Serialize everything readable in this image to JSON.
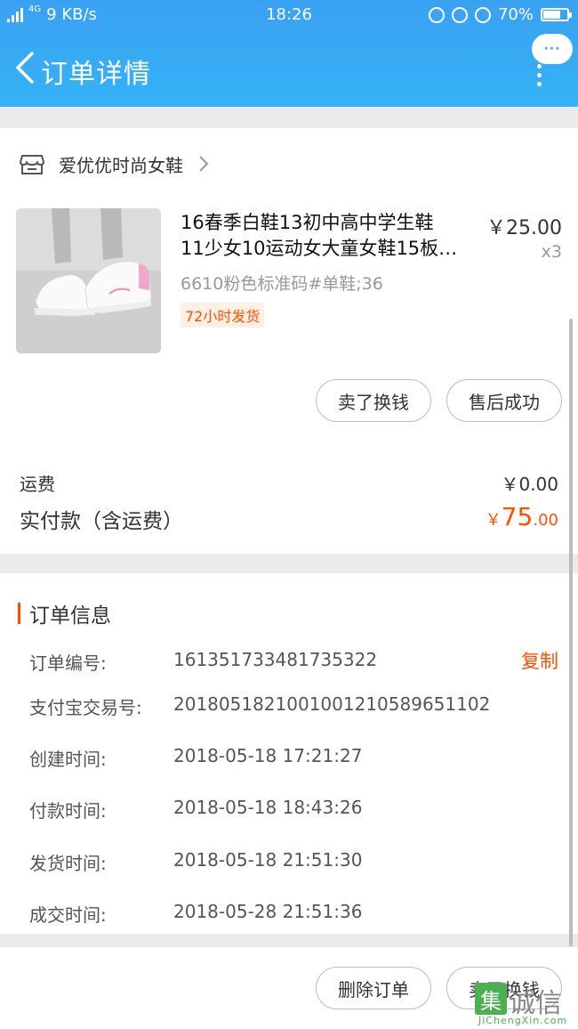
{
  "status_bar": {
    "network": "4G",
    "speed": "9 KB/s",
    "time": "18:26",
    "battery": "70%"
  },
  "nav": {
    "title": "订单详情",
    "more_label": "···"
  },
  "shop": {
    "name": "爱优优时尚女鞋"
  },
  "product": {
    "title_line1": "16春季白鞋13初中高中学生鞋",
    "title_line2": "11少女10运动女大童女鞋15板…",
    "price": "￥25.00",
    "qty": "x3",
    "sku": "6610粉色标准码#单鞋;36",
    "tag": "72小时发货"
  },
  "item_actions": {
    "sell": "卖了换钱",
    "after_sale": "售后成功"
  },
  "fees": {
    "shipping_label": "运费",
    "shipping_value": "￥0.00",
    "paid_label": "实付款（含运费）",
    "paid_currency": "￥",
    "paid_int": "75",
    "paid_dec": ".00"
  },
  "order_info": {
    "title": "订单信息",
    "copy_label": "复制",
    "rows": [
      {
        "label": "订单编号:",
        "value": "161351733481735322"
      },
      {
        "label": "支付宝交易号:",
        "value": "2018051821001001210589651102"
      },
      {
        "label": "创建时间:",
        "value": "2018-05-18 17:21:27"
      },
      {
        "label": "付款时间:",
        "value": "2018-05-18 18:43:26"
      },
      {
        "label": "发货时间:",
        "value": "2018-05-18 21:51:30"
      },
      {
        "label": "成交时间:",
        "value": "2018-05-28 21:51:36"
      }
    ]
  },
  "bottom_actions": {
    "delete": "删除订单",
    "sell": "卖了换钱"
  },
  "watermark": {
    "mark": "集",
    "text": "诚信",
    "url": "JiChengXin.com"
  },
  "colors": {
    "accent": "#ff5000",
    "header": "#3aa1f2"
  }
}
